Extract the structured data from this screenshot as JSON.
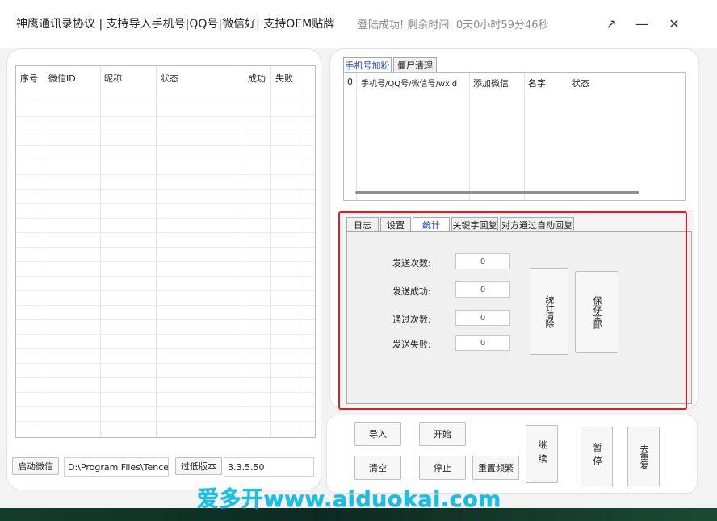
{
  "titlebar": {
    "title": "神鹰通讯录协议  | 支持导入手机号|QQ号|微信好| 支持OEM贴牌",
    "status": "登陆成功!  剩余时间: 0天0小时59分46秒",
    "restore_glyph": "↗",
    "minimize_glyph": "—",
    "close_glyph": "✕"
  },
  "left_grid": {
    "columns": [
      "序号",
      "微信ID",
      "昵称",
      "状态",
      "成功",
      "失败"
    ]
  },
  "left_bottom": {
    "start_wechat": "启动微信",
    "path": "D:\\Program Files\\Tencent",
    "low_version": "过低版本",
    "version": "3.3.5.50"
  },
  "top_tabs": [
    "手机号加粉",
    "僵尸清理"
  ],
  "list2_columns": [
    "0",
    "手机号/QQ号/微信号/wxid",
    "添加微信",
    "名字",
    "状态"
  ],
  "sub_tabs": [
    "日志",
    "设置",
    "统计",
    "关键字回复",
    "对方通过自动回复"
  ],
  "stats": {
    "rows": [
      {
        "label": "发送次数:",
        "value": "0"
      },
      {
        "label": "发送成功:",
        "value": "0"
      },
      {
        "label": "通过次数:",
        "value": "0"
      },
      {
        "label": "发送失败:",
        "value": "0"
      }
    ],
    "clear_btn": "统计清除",
    "save_btn": "保存全部"
  },
  "controls": {
    "import": "导入",
    "start": "开始",
    "clear": "清空",
    "stop": "停止",
    "reset_freq": "重置频繁",
    "continue": "继续",
    "pause": "暂停",
    "dedupe": "去重复"
  },
  "watermark": "爱多开www.aiduokai.com",
  "colors": {
    "active_tab": "#1b43c9",
    "highlight": "#e02020",
    "watermark": "#18bfe4"
  }
}
